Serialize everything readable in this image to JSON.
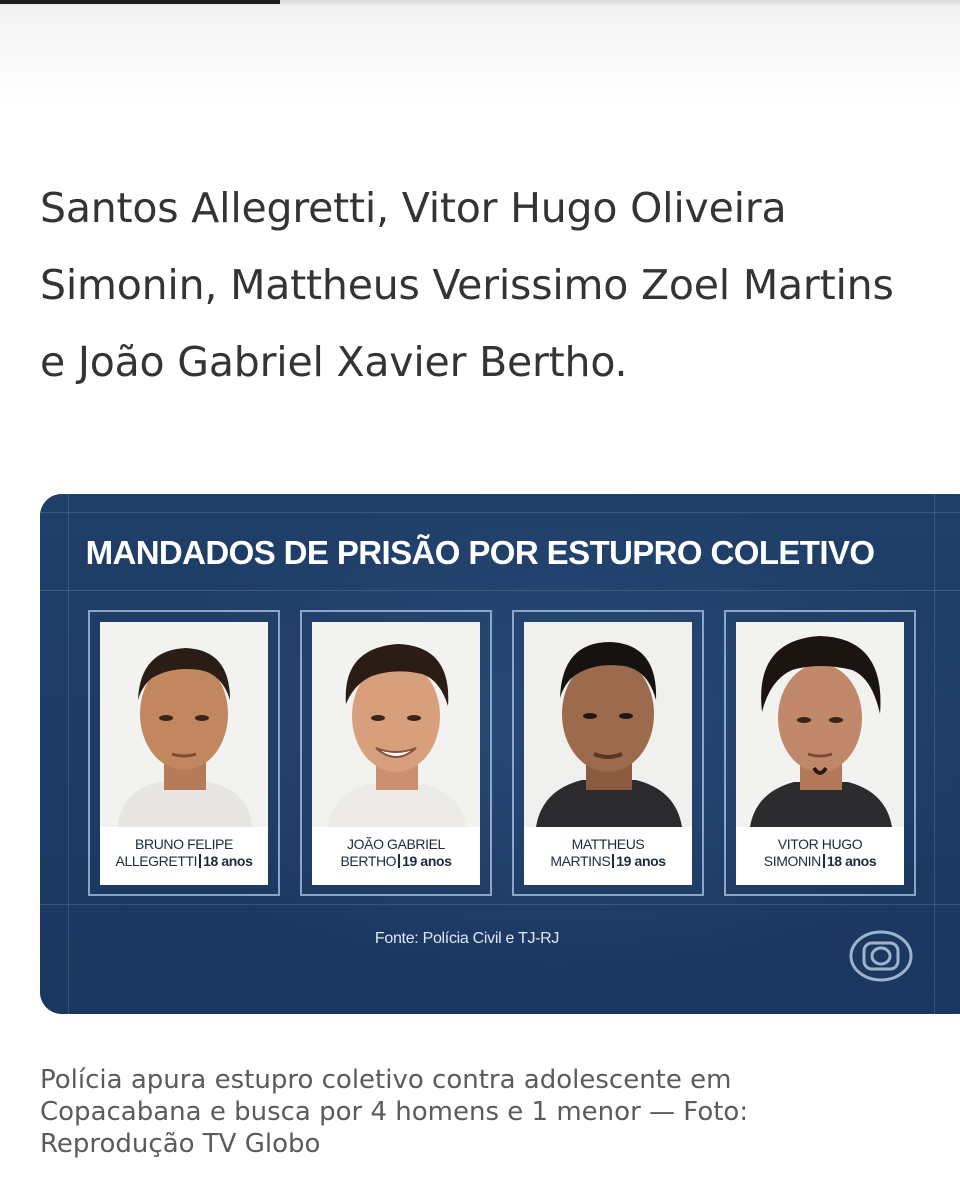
{
  "article": {
    "headline_lines": [
      "Santos Allegretti, Vitor Hugo Oliveira",
      "Simonin, Mattheus Verissimo Zoel Martins",
      "e João Gabriel Xavier Bertho."
    ],
    "caption_lines": [
      "Polícia apura estupro coletivo contra adolescente em",
      "Copacabana e busca por 4 homens e 1 menor — Foto:",
      "Reprodução TV Globo"
    ]
  },
  "graphic": {
    "title": "MANDADOS DE PRISÃO POR ESTUPRO COLETIVO",
    "source": "Fonte: Polícia Civil e TJ-RJ",
    "logo_icon": "tv-globo-logo-icon",
    "colors": {
      "panel": "#1d3b63",
      "card_border": "#afc8e6",
      "label_bg": "#ffffff"
    },
    "cards": [
      {
        "name_line1": "BRUNO FELIPE",
        "name_line2": "ALLEGRETTI",
        "age": "18 anos"
      },
      {
        "name_line1": "JOÃO GABRIEL",
        "name_line2": "BERTHO",
        "age": "19 anos"
      },
      {
        "name_line1": "MATTHEUS",
        "name_line2": "MARTINS",
        "age": "19 anos"
      },
      {
        "name_line1": "VITOR HUGO",
        "name_line2": "SIMONIN",
        "age": "18 anos"
      }
    ]
  }
}
